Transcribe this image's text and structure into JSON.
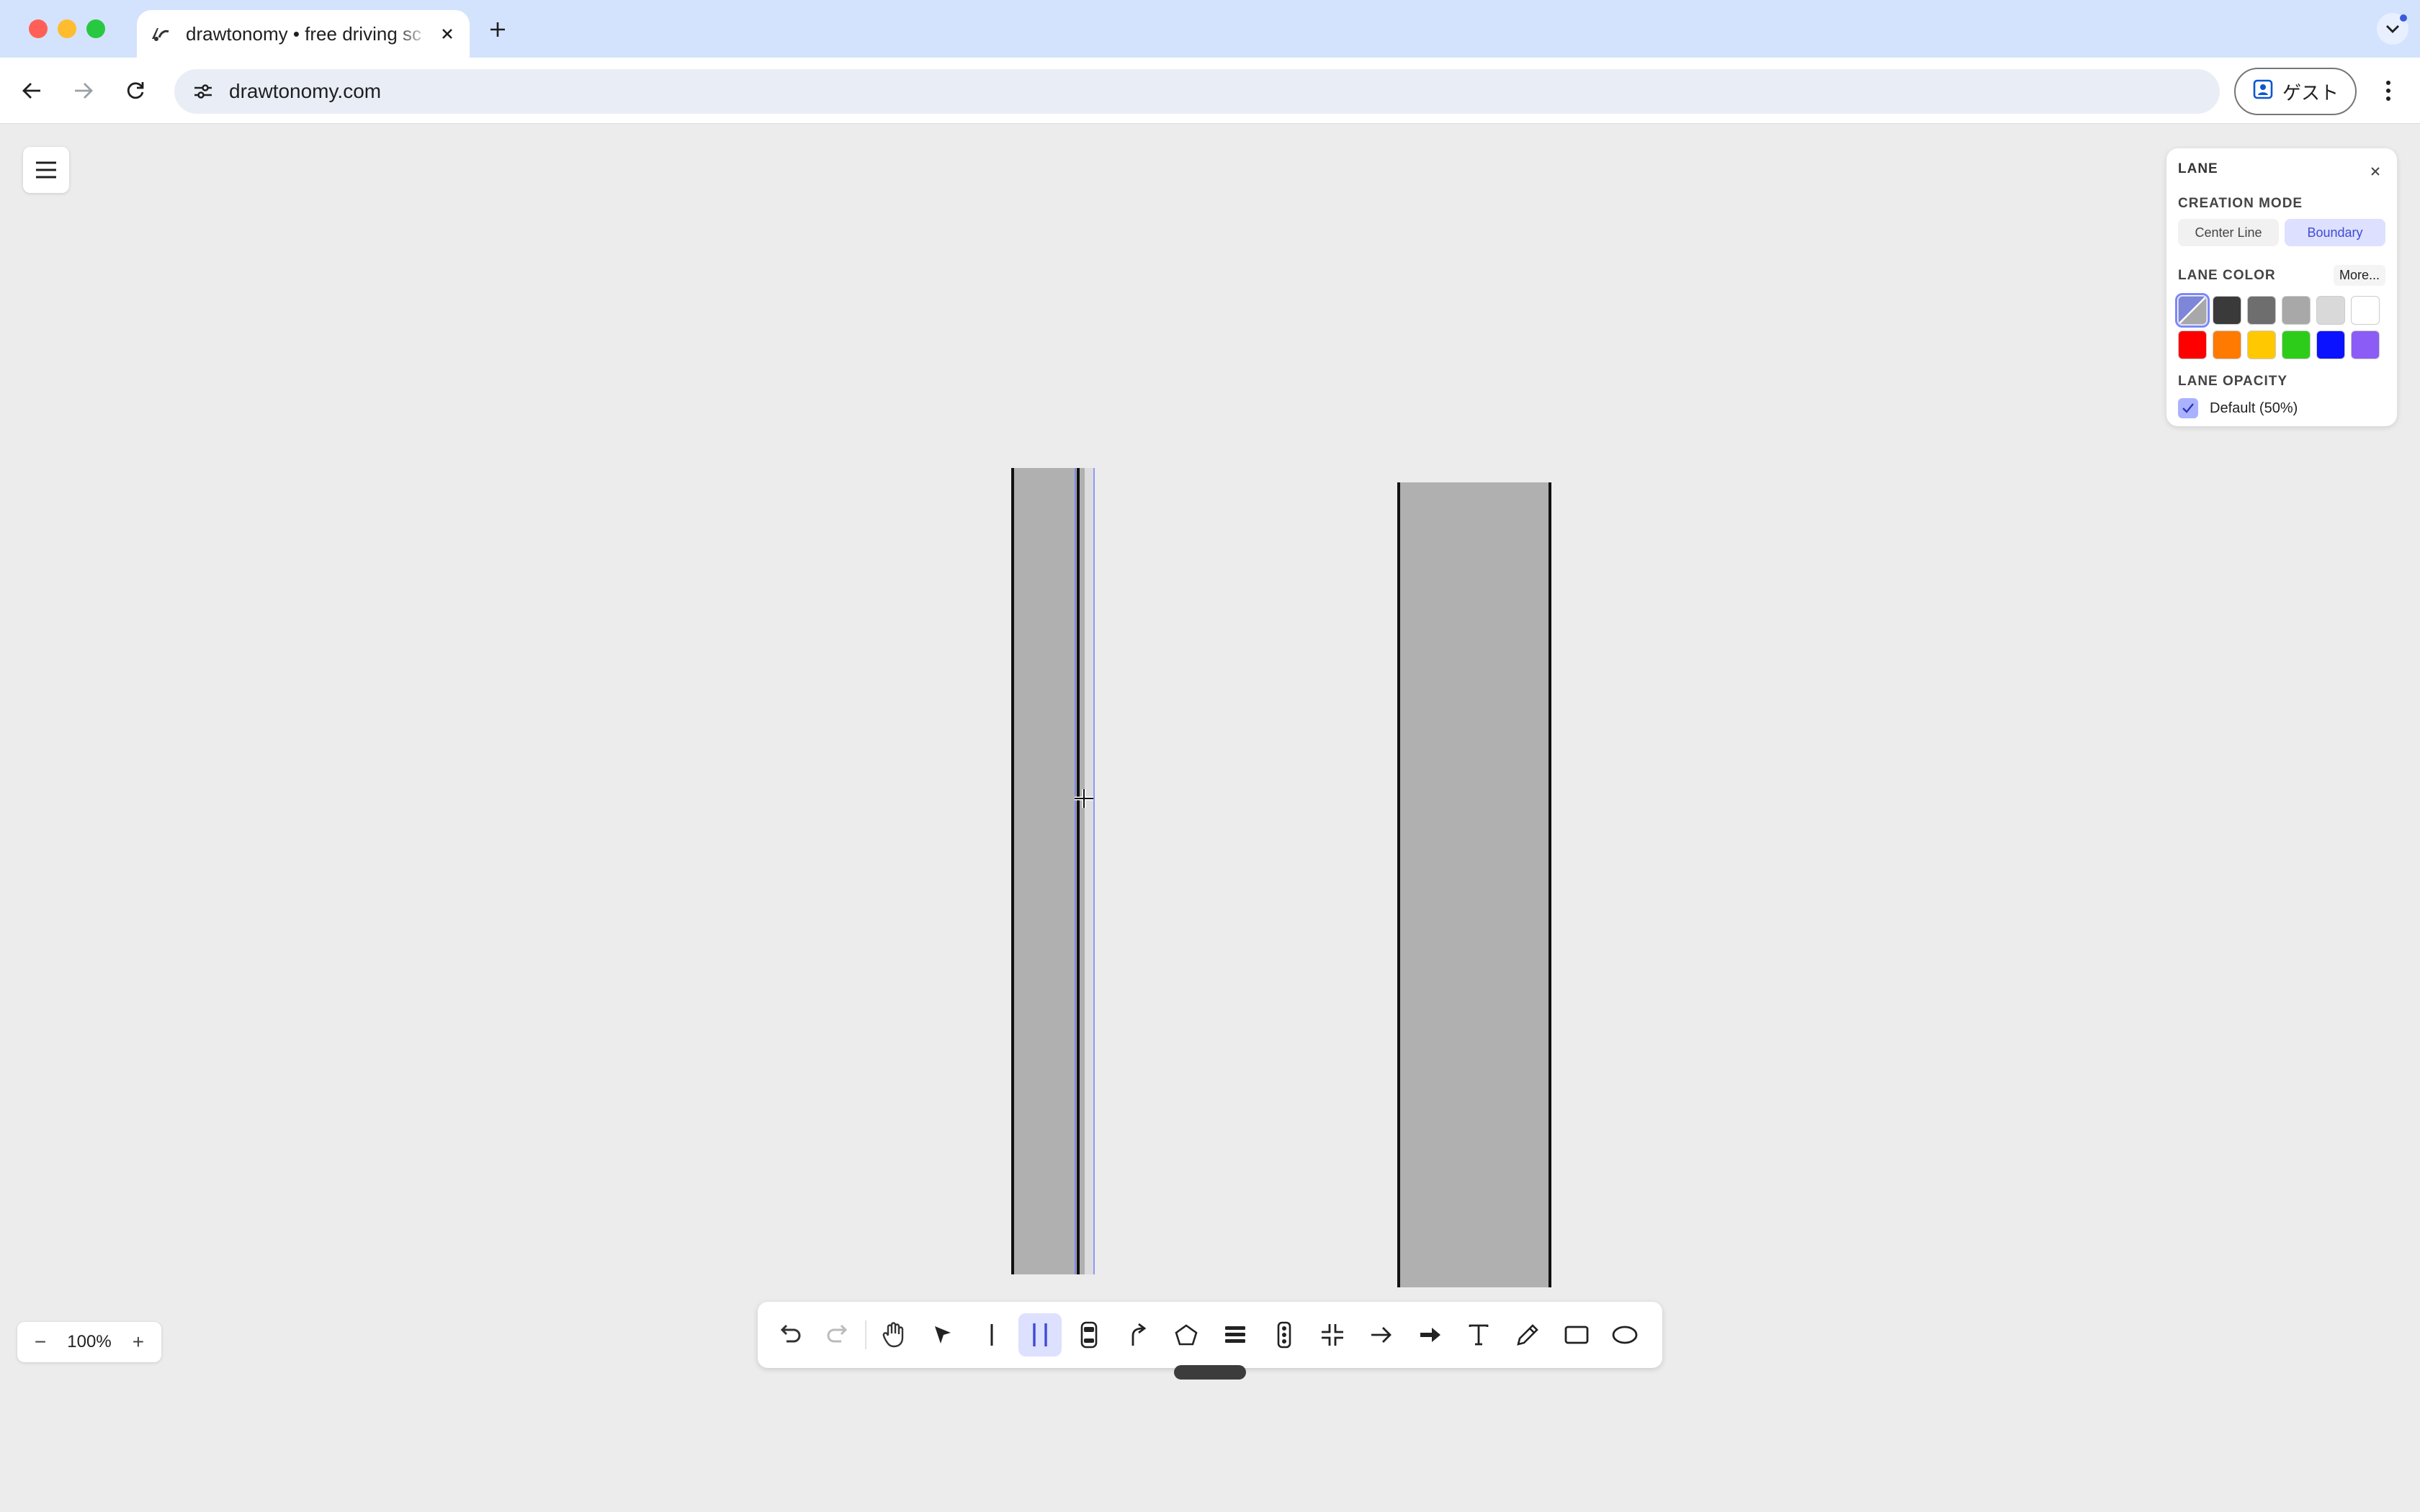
{
  "browser": {
    "tab_title": "drawtonomy • free driving sc",
    "url": "drawtonomy.com",
    "guest_label": "ゲスト"
  },
  "lane_panel": {
    "title": "LANE",
    "creation_mode_label": "CREATION MODE",
    "modes": [
      "Center Line",
      "Boundary"
    ],
    "active_mode": "Boundary",
    "lane_color_label": "LANE COLOR",
    "more_label": "More...",
    "colors": [
      "#ffffff",
      "#3a3a3a",
      "#6e6e6e",
      "#a8a8a8",
      "#d9d9d9",
      "#ffffff",
      "#ff0000",
      "#ff7a00",
      "#ffc800",
      "#2ecc1a",
      "#0a12ff",
      "#8b5cf6"
    ],
    "selected_color": "default",
    "lane_opacity_label": "LANE OPACITY",
    "opacity_option": "Default (50%)",
    "opacity_checked": true
  },
  "zoom": {
    "minus": "−",
    "value": "100%",
    "plus": "+"
  },
  "tools": [
    "undo-icon",
    "redo-icon",
    "hand-icon",
    "select-arrow-icon",
    "line-icon",
    "lane-icon",
    "vehicle-icon",
    "path-icon",
    "polygon-icon",
    "crosswalk-icon",
    "traffic-light-icon",
    "intersection-icon",
    "arrow-icon",
    "bold-arrow-icon",
    "text-icon",
    "pencil-icon",
    "rectangle-icon",
    "ellipse-icon"
  ],
  "active_tool": "lane-icon",
  "accent": "#dde0ff"
}
